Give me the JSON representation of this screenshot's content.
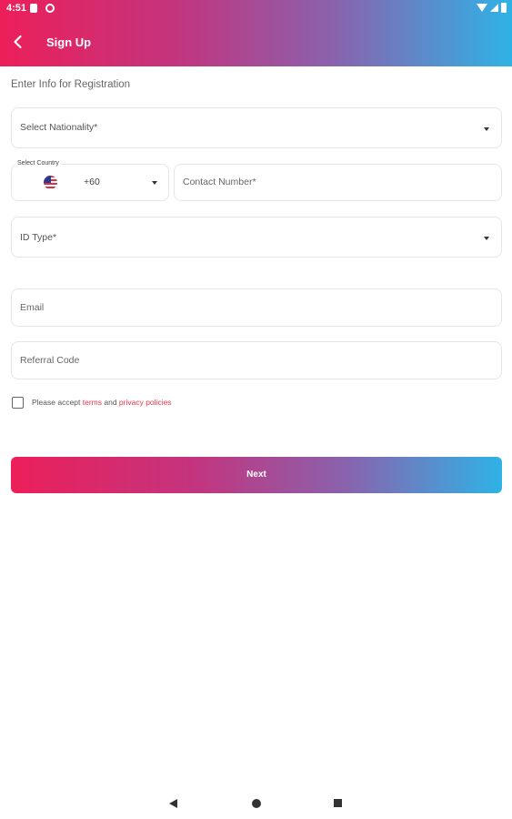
{
  "status_bar": {
    "time": "4:51"
  },
  "header": {
    "title": "Sign Up"
  },
  "form": {
    "subtitle": "Enter Info for Registration",
    "nationality_placeholder": "Select Nationality*",
    "country_label": "Select Country",
    "dial_code": "+60",
    "contact_placeholder": "Contact Number*",
    "id_type_placeholder": "ID Type*",
    "email_placeholder": "Email",
    "referral_placeholder": "Referral Code",
    "terms_checked": false,
    "terms_prefix": "Please accept ",
    "terms_link": "terms",
    "terms_and": " and ",
    "privacy_link": "privacy policies",
    "next_label": "Next"
  },
  "colors": {
    "gradient_start": "#ec1f5a",
    "gradient_end": "#2fb2e6",
    "link": "#e8344e"
  },
  "icons": {
    "back": "arrow-left-icon",
    "dropdown": "caret-down-icon",
    "flag": "us-flag-icon",
    "nav": [
      "nav-back-icon",
      "nav-home-icon",
      "nav-recents-icon"
    ]
  }
}
